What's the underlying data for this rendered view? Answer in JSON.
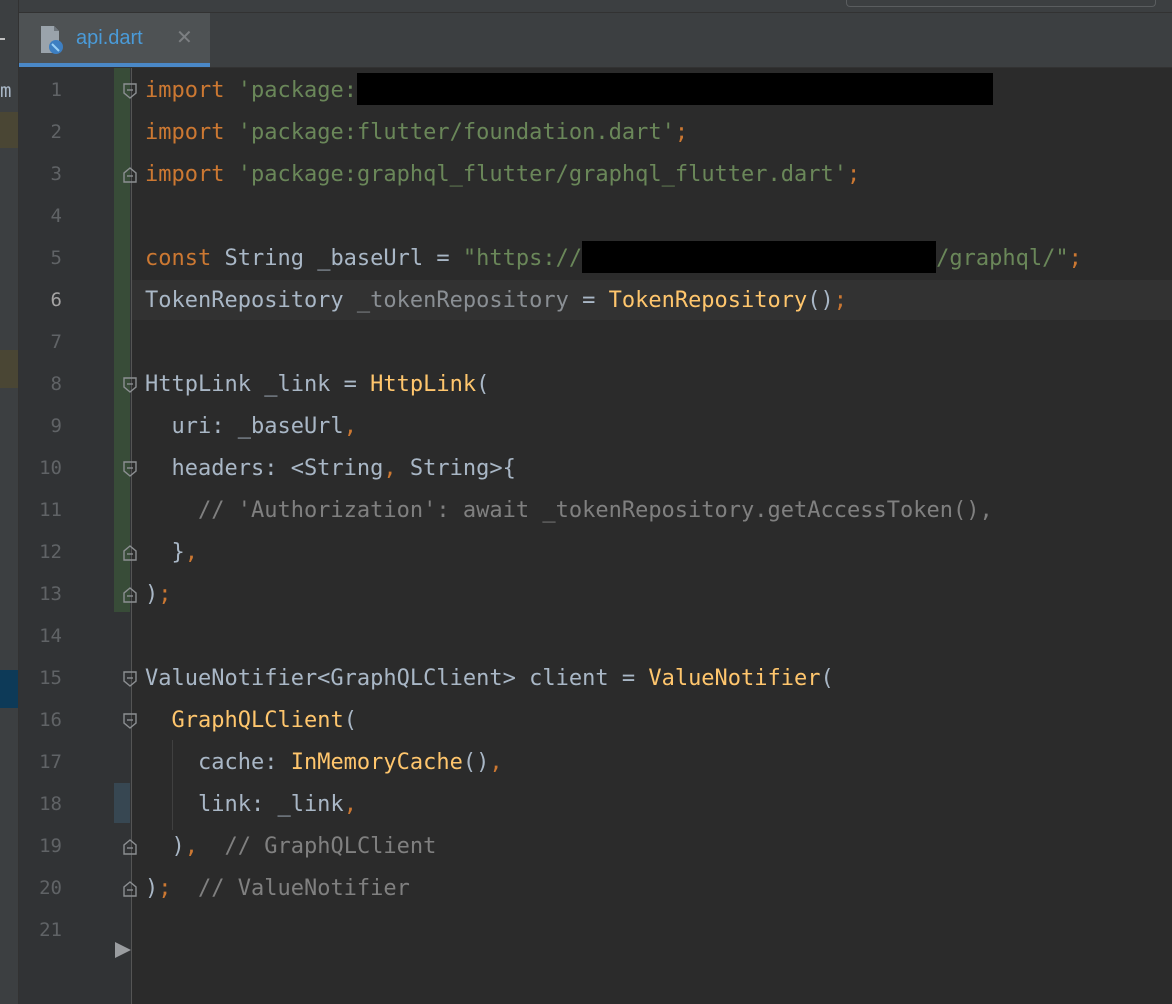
{
  "window": {
    "sidebar_fragment": "m"
  },
  "tab": {
    "label": "api.dart",
    "close_glyph": "✕",
    "icon": "dart-file-icon"
  },
  "editor": {
    "current_line": 6,
    "line_numbers": [
      "1",
      "2",
      "3",
      "4",
      "5",
      "6",
      "7",
      "8",
      "9",
      "10",
      "11",
      "12",
      "13",
      "14",
      "15",
      "16",
      "17",
      "18",
      "19",
      "20",
      "21"
    ],
    "lines": {
      "l1": {
        "kw": "import",
        "str": "'package:"
      },
      "l2": {
        "kw": "import",
        "str": "'package:flutter/foundation.dart'",
        "semi": ";"
      },
      "l3": {
        "kw": "import",
        "str": "'package:graphql_flutter/graphql_flutter.dart'",
        "semi": ";"
      },
      "l5": {
        "kw": "const",
        "type": " String _baseUrl = ",
        "str_a": "\"https://",
        "str_b": "/graphql/\"",
        "semi": ";"
      },
      "l6": {
        "type": "TokenRepository ",
        "var": "_tokenRepository",
        "eq": " = ",
        "fn": "TokenRepository",
        "paren": "()",
        "semi": ";"
      },
      "l8": {
        "type": "HttpLink _link = ",
        "fn": "HttpLink",
        "paren": "("
      },
      "l9": {
        "text": "  uri: _baseUrl",
        "comma": ","
      },
      "l10": {
        "text_a": "  headers: <String",
        "comma": ",",
        "text_b": " String>{"
      },
      "l11": {
        "comment": "    // 'Authorization': await _tokenRepository.getAccessToken(),"
      },
      "l12": {
        "text": "  }",
        "comma": ","
      },
      "l13": {
        "text": ")",
        "semi": ";"
      },
      "l15": {
        "type": "ValueNotifier<GraphQLClient> client = ",
        "fn": "ValueNotifier",
        "paren": "("
      },
      "l16": {
        "indent": "  ",
        "fn": "GraphQLClient",
        "paren": "("
      },
      "l17": {
        "text": "    cache: ",
        "fn": "InMemoryCache",
        "paren": "()",
        "comma": ","
      },
      "l18": {
        "text": "    link: _link",
        "comma": ","
      },
      "l19": {
        "text": "  )",
        "comma": ",",
        "comment": "  // GraphQLClient"
      },
      "l20": {
        "text": ")",
        "semi": ";",
        "comment": "  // ValueNotifier"
      }
    }
  },
  "colors": {
    "background": "#2b2b2b",
    "keyword": "#cc7832",
    "string": "#6a8759",
    "function": "#ffc66d",
    "comment": "#808080",
    "identifier": "#a9b7c6",
    "tab_accent": "#4a88c7"
  }
}
